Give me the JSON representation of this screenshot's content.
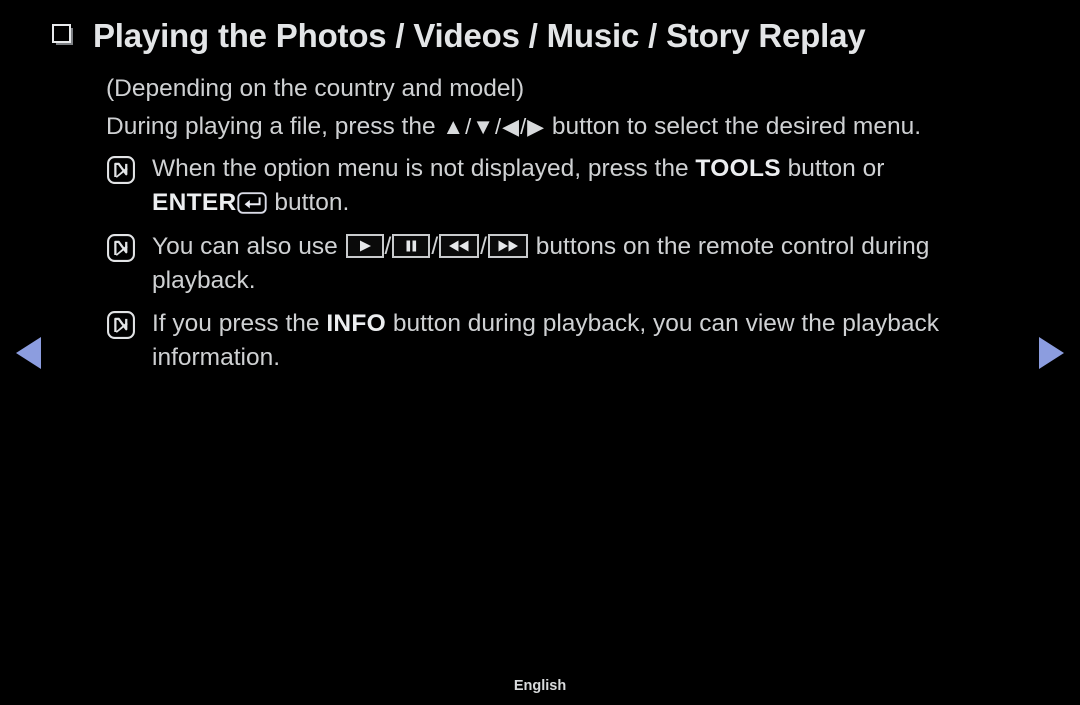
{
  "screen": {
    "background_color": "#000000",
    "text_color": "#cfd1d3",
    "accent_color": "#8c9ddf"
  },
  "title": {
    "bullet_icon": "square-bullet-icon",
    "text": "Playing the Photos / Videos / Music / Story Replay"
  },
  "intro": {
    "note": "(Depending on the country and model)",
    "instruction_before": "During playing a file, press the ",
    "direction_buttons": "▲/▼/◀/▶",
    "instruction_after": " button to select the desired menu."
  },
  "notes": [
    {
      "icon": "note-n-mark-icon",
      "text_before": "When the option menu is not displayed, press the ",
      "keyword_1": "TOOLS",
      "text_middle": " button or ",
      "keyword_2": "ENTER",
      "key_icon": "enter-key-icon",
      "text_after": " button."
    },
    {
      "icon": "note-n-mark-icon",
      "text_before": "You can also use ",
      "buttons": [
        "play-button-icon",
        "pause-button-icon",
        "rewind-button-icon",
        "fast-forward-button-icon"
      ],
      "text_after": " buttons on the remote control during playback."
    },
    {
      "icon": "note-n-mark-icon",
      "text_before": "If you press the ",
      "keyword_1": "INFO",
      "text_after": " button during playback, you can view the playback information."
    }
  ],
  "navigation": {
    "previous_icon": "left-triangle-icon",
    "next_icon": "right-triangle-icon"
  },
  "footer": {
    "language": "English"
  }
}
